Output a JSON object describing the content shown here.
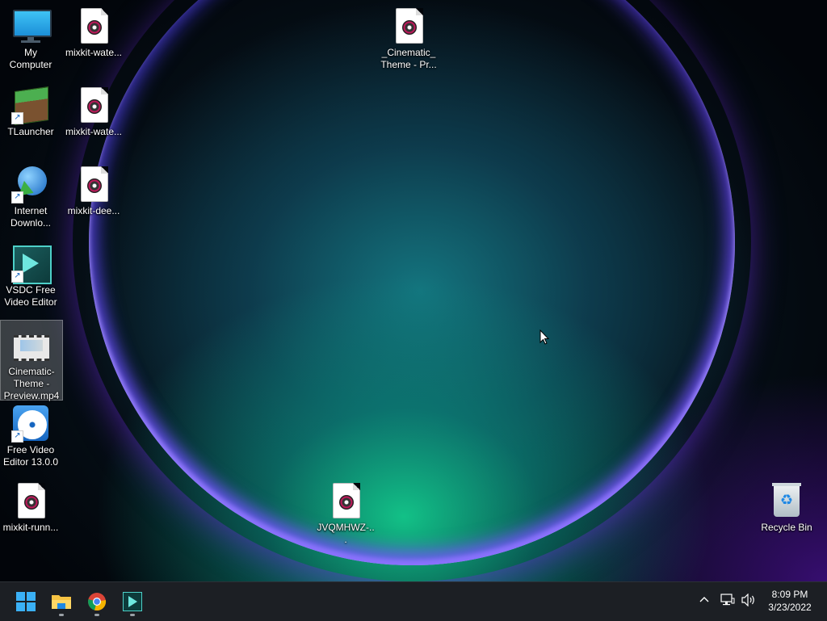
{
  "desktop": {
    "icons": [
      {
        "label": "My Computer",
        "type": "computer-icon"
      },
      {
        "label": "mixkit-wate...",
        "type": "audio-file-icon"
      },
      {
        "label": "_Cinematic_ Theme - Pr...",
        "type": "audio-file-icon"
      },
      {
        "label": "TLauncher",
        "type": "minecraft-block-icon"
      },
      {
        "label": "mixkit-wate...",
        "type": "audio-file-icon"
      },
      {
        "label": "Internet Downlo...",
        "type": "download-globe-icon"
      },
      {
        "label": "mixkit-dee...",
        "type": "audio-file-icon"
      },
      {
        "label": "VSDC Free Video Editor",
        "type": "vsdc-icon"
      },
      {
        "label": "Cinematic-Theme - Preview.mp4",
        "type": "video-file-icon"
      },
      {
        "label": "Free Video Editor 13.0.0",
        "type": "film-reel-icon"
      },
      {
        "label": "mixkit-runn...",
        "type": "audio-file-icon"
      },
      {
        "label": "JVQMHWZ-...",
        "type": "audio-file-icon"
      },
      {
        "label": "Recycle Bin",
        "type": "recycle-bin-icon"
      }
    ]
  },
  "taskbar": {
    "apps": [
      "start-icon",
      "file-explorer-icon",
      "chrome-icon",
      "vsdc-icon"
    ],
    "tray": {
      "time": "8:09 PM",
      "date": "3/23/2022"
    }
  },
  "colors": {
    "taskbar_bg": "#1c1f24",
    "accent_blue": "#0078d4"
  }
}
